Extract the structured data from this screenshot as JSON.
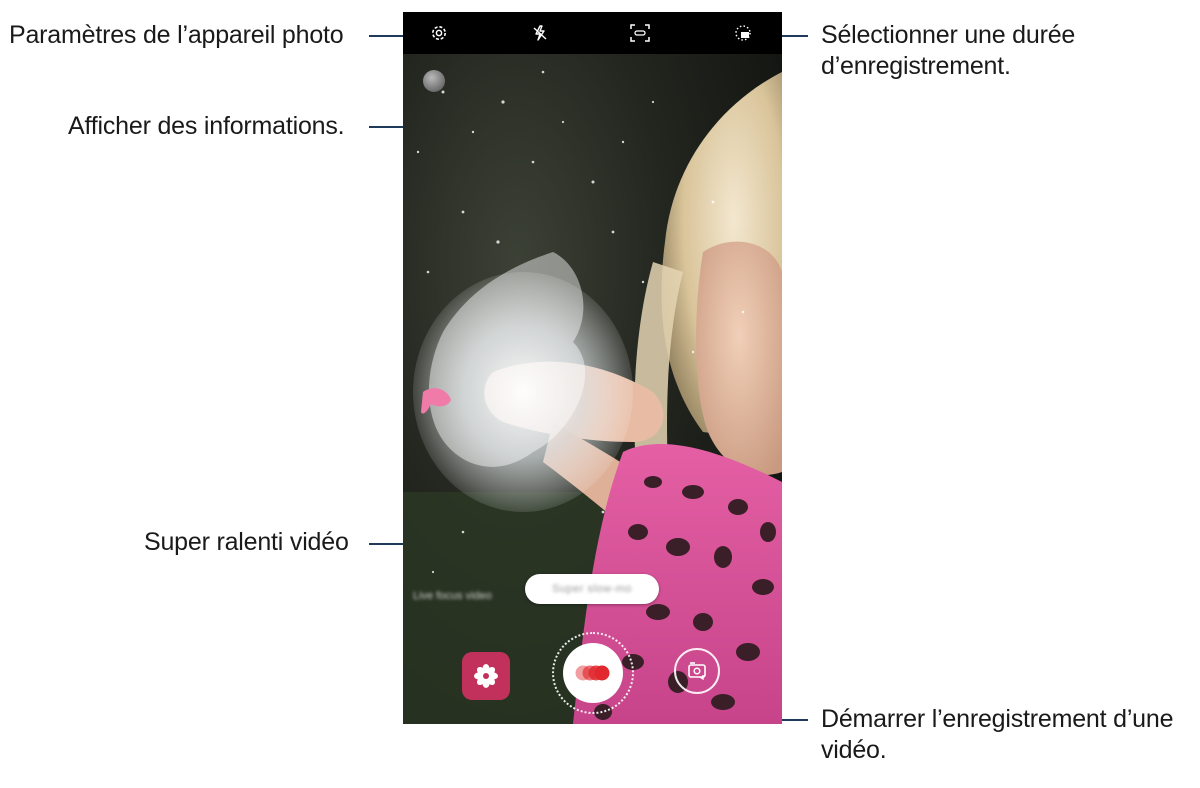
{
  "callouts": {
    "settings": "Paramètres de l’appareil photo",
    "info": "Afficher des informations.",
    "duration_line1": "Sélectionner une durée",
    "duration_line2": "d’enregistrement.",
    "super_slow": "Super ralenti vidéo",
    "record_line1": "Démarrer l’enregistrement d’une",
    "record_line2": "vidéo."
  },
  "camera": {
    "topbar_icons": [
      "gear-icon",
      "flash-off-icon",
      "motion-detection-icon",
      "recording-duration-icon"
    ],
    "mode_label": "Super slow-mo",
    "mode_strip_text": "Live focus video",
    "icons": {
      "gallery": "flower-icon",
      "shutter": "super-slow-mo-record-icon",
      "switch": "switch-camera-icon",
      "info": "info-icon"
    }
  },
  "colors": {
    "callout_line": "#1f3a5a",
    "gallery_button": "#c2305c",
    "record_dot": "#e0282e"
  }
}
